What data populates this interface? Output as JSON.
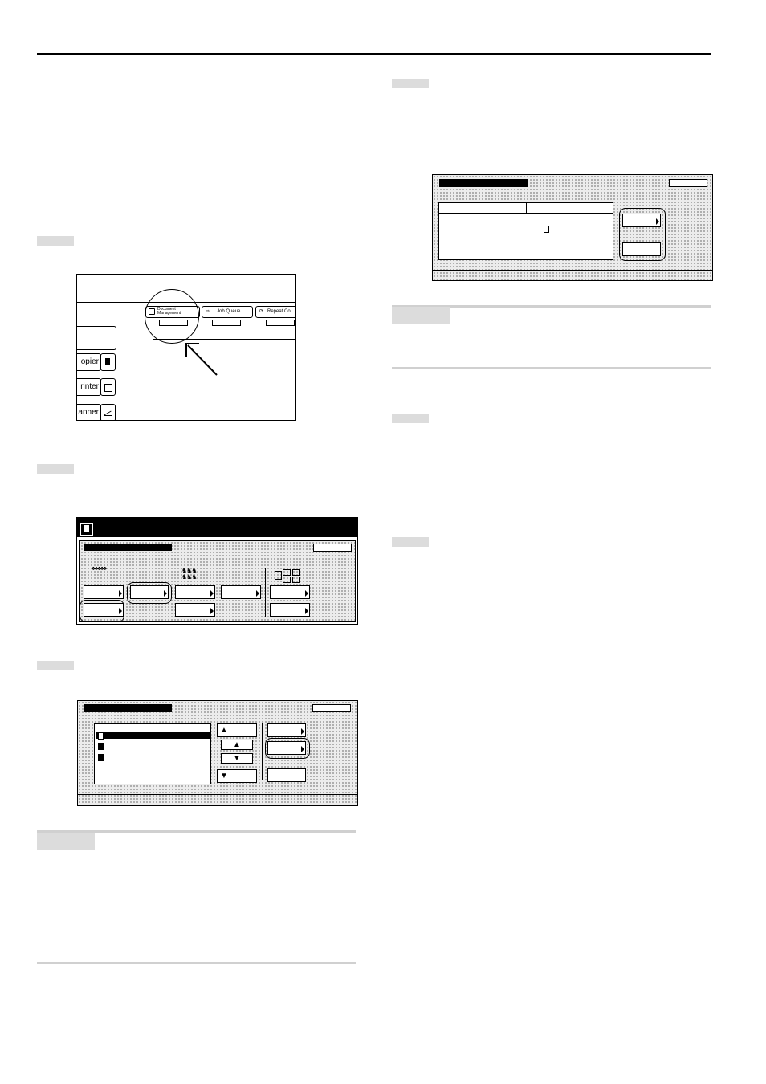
{
  "figure1": {
    "tabs": [
      {
        "label": "Document\nManagement"
      },
      {
        "label": "Job Queue"
      },
      {
        "label": "Repeat Co"
      }
    ],
    "side_buttons": [
      {
        "label": "opier"
      },
      {
        "label": "rinter"
      },
      {
        "label": "anner"
      }
    ]
  }
}
